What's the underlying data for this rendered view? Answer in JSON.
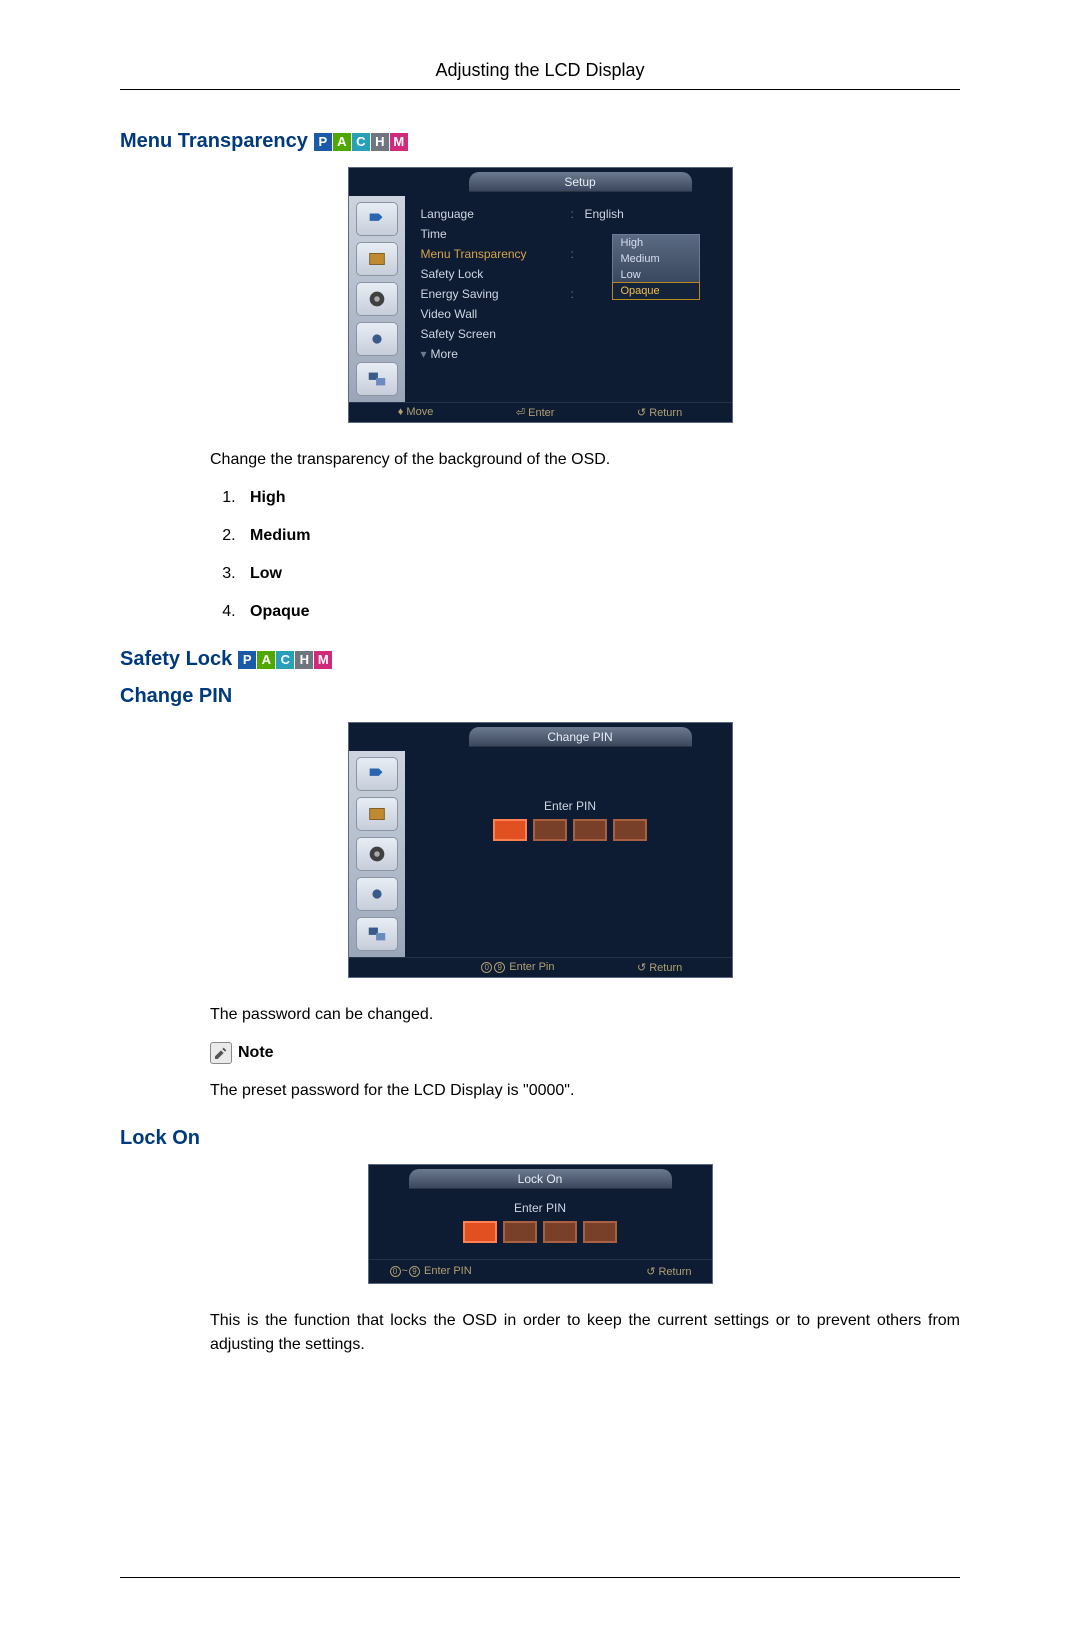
{
  "page_header": "Adjusting the LCD Display",
  "pachm": {
    "p": "P",
    "a": "A",
    "c": "C",
    "h": "H",
    "m": "M"
  },
  "sections": {
    "menu_transparency": {
      "title": "Menu Transparency",
      "desc": "Change the transparency of the background of the OSD.",
      "options": [
        "High",
        "Medium",
        "Low",
        "Opaque"
      ]
    },
    "safety_lock": {
      "title": "Safety Lock"
    },
    "change_pin": {
      "title": "Change PIN",
      "desc": "The password can be changed.",
      "note_label": "Note",
      "note_text": "The preset password for the LCD Display is \"0000\"."
    },
    "lock_on": {
      "title": "Lock On",
      "desc": "This is the function that locks the OSD in order to keep the current settings or to prevent others from adjusting the settings."
    }
  },
  "osd_setup": {
    "title": "Setup",
    "rows": {
      "language": {
        "label": "Language",
        "value": "English"
      },
      "time": {
        "label": "Time"
      },
      "menu_transparency": {
        "label": "Menu Transparency"
      },
      "safety_lock": {
        "label": "Safety Lock"
      },
      "energy_saving": {
        "label": "Energy Saving"
      },
      "video_wall": {
        "label": "Video Wall"
      },
      "safety_screen": {
        "label": "Safety Screen"
      },
      "more": {
        "label": "More"
      }
    },
    "submenu": {
      "high": "High",
      "medium": "Medium",
      "low": "Low",
      "opaque": "Opaque"
    },
    "footer": {
      "move": "Move",
      "enter": "Enter",
      "return": "Return"
    }
  },
  "osd_changepin": {
    "title": "Change PIN",
    "enter_pin": "Enter PIN",
    "footer": {
      "enterpin": "Enter Pin",
      "return": "Return"
    }
  },
  "osd_lockon": {
    "title": "Lock On",
    "enter_pin": "Enter PIN",
    "footer": {
      "enterpin": "Enter PIN",
      "return": "Return"
    },
    "digits": {
      "zero": "0",
      "nine": "9",
      "sep": "~"
    }
  }
}
